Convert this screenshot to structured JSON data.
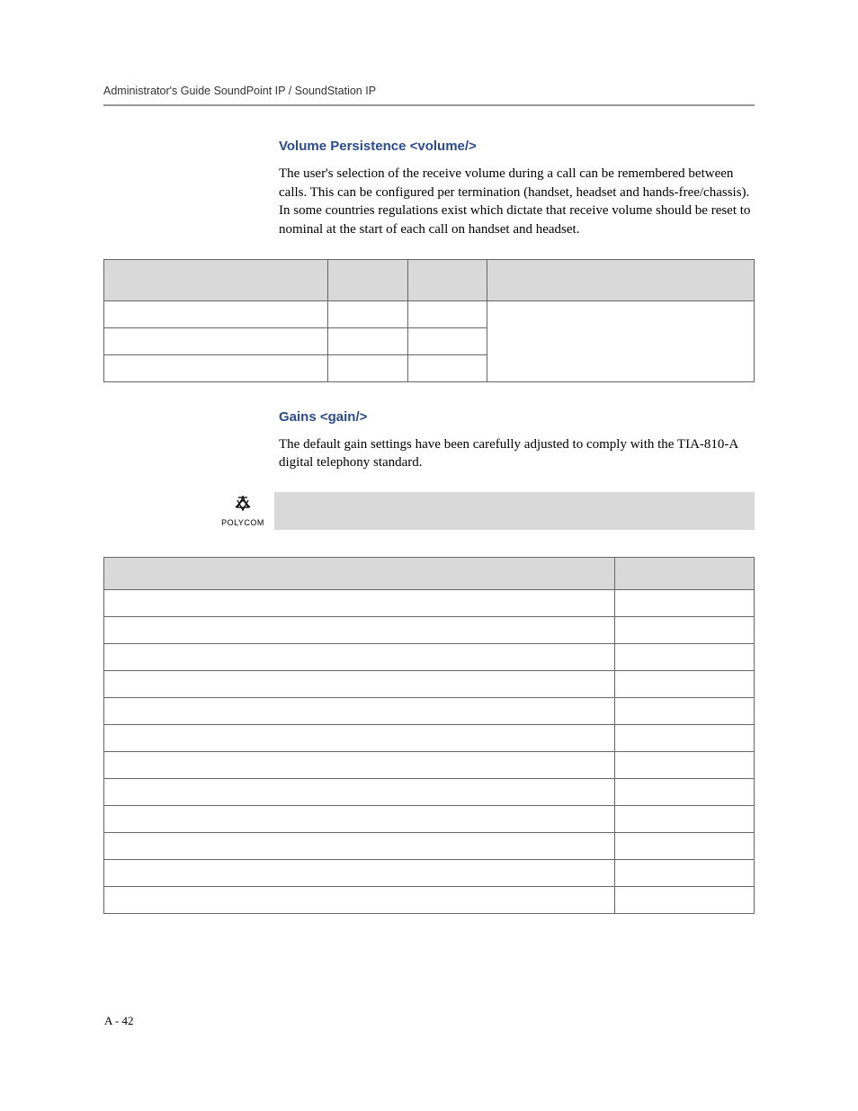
{
  "header": {
    "running_title": "Administrator's Guide SoundPoint IP / SoundStation IP"
  },
  "section1": {
    "heading": "Volume Persistence <volume/>",
    "body": "The user's selection of the receive volume during a call can be remembered between calls. This can be configured per termination (handset, headset and hands-free/chassis). In some countries regulations exist which dictate that receive volume should be reset to nominal at the start of each call on handset and headset."
  },
  "section2": {
    "heading": "Gains <gain/>",
    "body": "The default gain settings have been carefully adjusted to comply with the TIA-810-A digital telephony standard."
  },
  "note": {
    "brand": "POLYCOM"
  },
  "footer": {
    "page_number": "A - 42"
  }
}
